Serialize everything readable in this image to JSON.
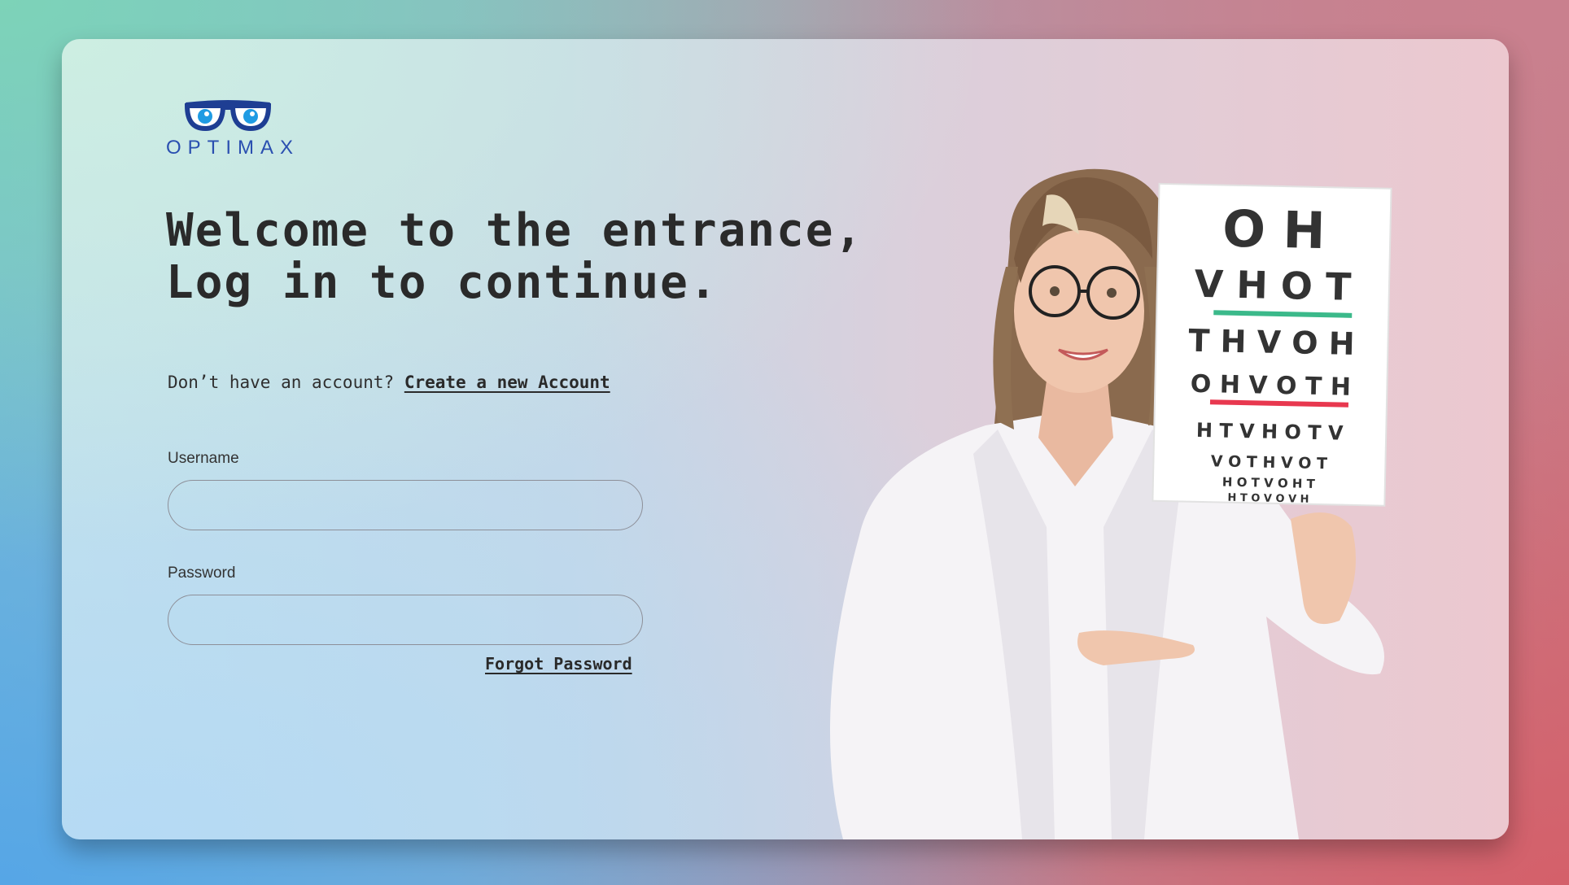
{
  "brand": {
    "name": "OPTIMAX",
    "logo_icon": "glasses-icon",
    "logo_color": "#2a4fb0"
  },
  "headline": "Welcome to the entrance,\nLog in to continue.",
  "signup": {
    "prompt": "Don’t have an account?",
    "link_label": "Create a new Account"
  },
  "form": {
    "username": {
      "label": "Username",
      "value": "",
      "placeholder": ""
    },
    "password": {
      "label": "Password",
      "value": "",
      "placeholder": ""
    },
    "forgot_label": "Forgot Password"
  },
  "eye_chart": {
    "rows": [
      "O H",
      "V H O T",
      "T H V O H",
      "O H V O T H",
      "H T V H O T V",
      "V O T H V O T",
      "H O T V O H T",
      "H T O V O V H"
    ],
    "line_colors": {
      "green": "#3bb98a",
      "red": "#e8384f"
    }
  }
}
